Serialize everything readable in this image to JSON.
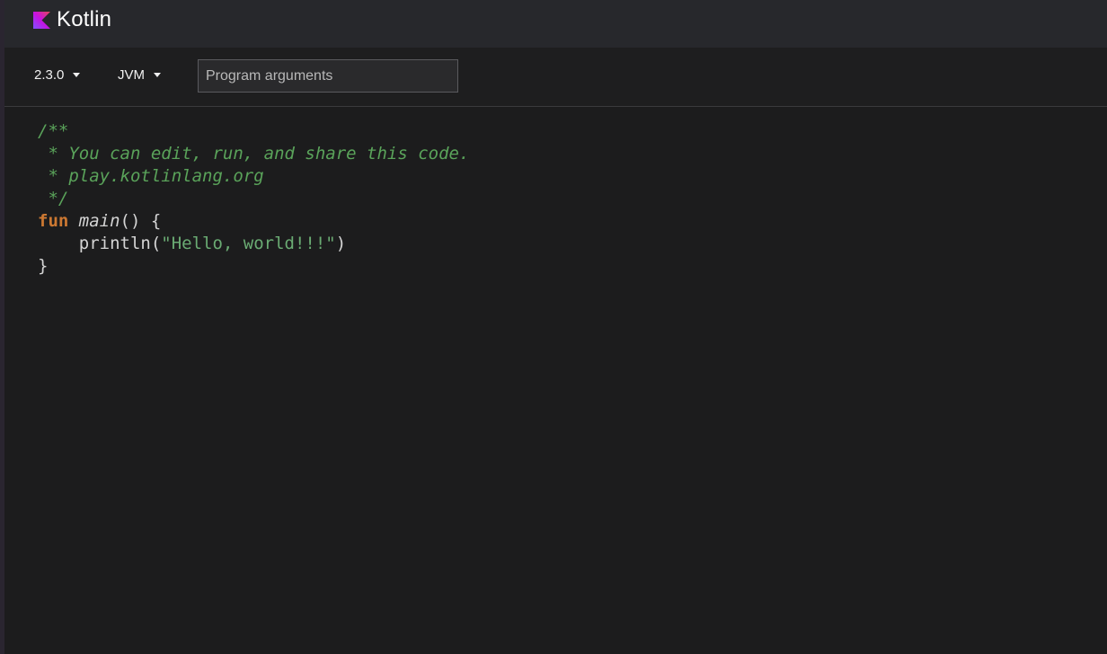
{
  "header": {
    "logo_text": "Kotlin",
    "logo_colors": [
      "#7f52ff",
      "#c811e1",
      "#e54857"
    ]
  },
  "toolbar": {
    "version_label": "2.3.0",
    "platform_label": "JVM",
    "args_placeholder": "Program arguments",
    "args_value": ""
  },
  "editor": {
    "lines": [
      "/**",
      " * You can edit, run, and share this code.",
      " * play.kotlinlang.org",
      " */",
      "fun",
      "main",
      "() {",
      "    println(",
      "\"Hello, world!!!\"",
      ")",
      "}"
    ]
  }
}
